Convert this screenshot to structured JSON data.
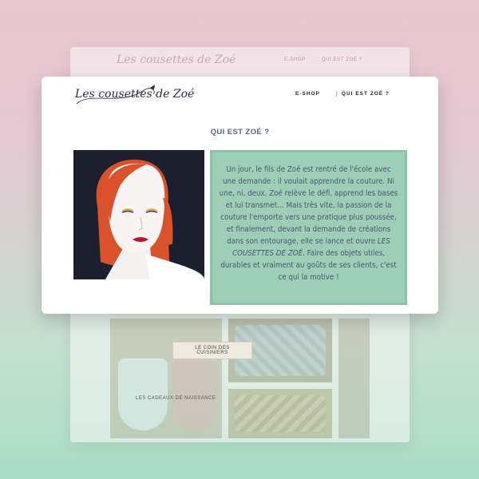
{
  "back": {
    "logo": "Les cousettes de Zoé",
    "nav": [
      "E-SHOP",
      "QUI EST ZOÉ ?"
    ],
    "buttons": {
      "cuisine": "LE COIN DES CUISINIERS",
      "cadeaux": "LES CADEAUX DE NAISSANCE"
    }
  },
  "header": {
    "logo": "Les cousettes de Zoé",
    "nav": [
      {
        "label": "E-SHOP"
      },
      {
        "label": "QUI EST ZOÉ ?"
      }
    ]
  },
  "main": {
    "title": "QUI EST ZOÉ ?",
    "paragraph_before": "Un jour, le fils de Zoé est rentré de l'école avec une demande : il voulait apprendre la couture. Ni une, ni, deux, Zoé relève le défi, apprend les bases et lui transmet… Mais très vite, la passion de la couture l'emporte vers une pratique plus poussée, et finalement, devant la demande de créations dans son entourage, elle se lance et ouvre ",
    "brand_emphasis": "LES COUSETTES DE ZOÉ",
    "paragraph_after": ". Faire des objets utiles, durables et vraiment au goûts de ses clients, c'est ce qui la motive !"
  },
  "colors": {
    "accent": "#9ccfb6",
    "text": "#4e5375",
    "portrait_bg": "#1c1f2e",
    "hair": "#d9522b"
  }
}
